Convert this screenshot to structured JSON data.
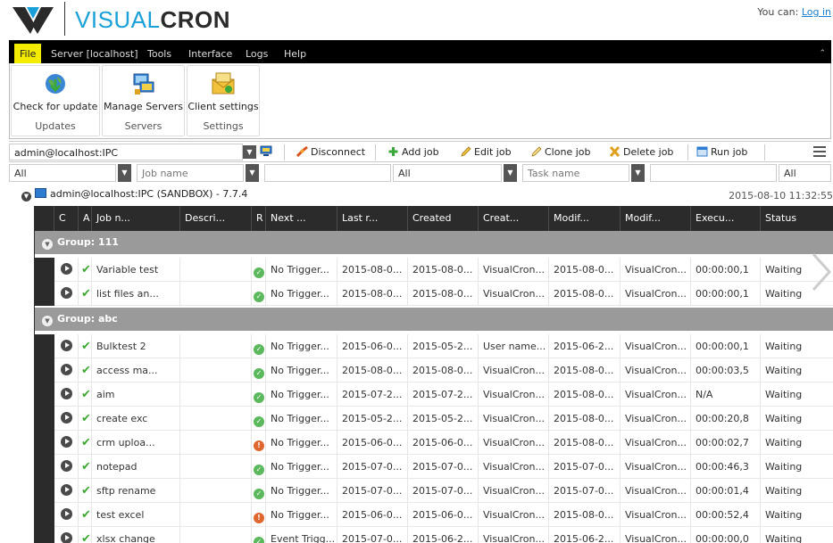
{
  "brand": {
    "text_light": "VISUAL",
    "text_bold": "CRON"
  },
  "account": {
    "prefix": "You can: ",
    "login_link": "Log in"
  },
  "menu": {
    "items": [
      {
        "label": "File",
        "active": true
      },
      {
        "label": "Server [localhost]",
        "active": false
      },
      {
        "label": "Tools",
        "active": false
      },
      {
        "label": "Interface",
        "active": false
      },
      {
        "label": "Logs",
        "active": false
      },
      {
        "label": "Help",
        "active": false
      }
    ],
    "collapse_icon": "chevron-up-icon"
  },
  "ribbon": {
    "groups": [
      {
        "button": "Check for update",
        "group": "Updates",
        "icon": "globe-update-icon"
      },
      {
        "button": "Manage Servers",
        "group": "Servers",
        "icon": "servers-icon"
      },
      {
        "button": "Client settings",
        "group": "Settings",
        "icon": "settings-envelope-icon"
      }
    ]
  },
  "toolbar": {
    "server_combo": "admin@localhost:IPC",
    "disconnect": "Disconnect",
    "add_job": "Add job",
    "edit_job": "Edit job",
    "clone_job": "Clone job",
    "delete_job": "Delete job",
    "run_job": "Run job"
  },
  "filters": {
    "group": "All",
    "job_name_placeholder": "Job name",
    "job_name_value": "",
    "status": "All",
    "task_name_placeholder": "Task name",
    "task_name_value": "",
    "task_status": "All"
  },
  "connection": {
    "label": "admin@localhost:IPC (SANDBOX) - 7.7.4",
    "timestamp": "2015-08-10 11:32:55"
  },
  "grid": {
    "columns": [
      "C",
      "A",
      "Job n...",
      "Descri...",
      "R",
      "Next ...",
      "Last r...",
      "Created",
      "Creat...",
      "Modif...",
      "Modif...",
      "Execu...",
      "Status"
    ],
    "groups": [
      {
        "label": "Group: 111",
        "rows": [
          {
            "name": "Variable test",
            "desc": "",
            "result": "ok",
            "next": "No Trigger...",
            "last": "2015-08-0...",
            "created": "2015-08-0...",
            "created_by": "VisualCron...",
            "modified": "2015-08-0...",
            "modified_by": "VisualCron...",
            "exec": "00:00:00,1",
            "status": "Waiting"
          },
          {
            "name": "list files an...",
            "desc": "",
            "result": "ok",
            "next": "No Trigger...",
            "last": "2015-08-0...",
            "created": "2015-08-0...",
            "created_by": "VisualCron...",
            "modified": "2015-08-0...",
            "modified_by": "VisualCron...",
            "exec": "00:00:00,1",
            "status": "Waiting"
          }
        ]
      },
      {
        "label": "Group: abc",
        "rows": [
          {
            "name": "Bulktest 2",
            "desc": "",
            "result": "ok",
            "next": "No Trigger...",
            "last": "2015-06-0...",
            "created": "2015-05-2...",
            "created_by": "User name...",
            "modified": "2015-06-2...",
            "modified_by": "VisualCron...",
            "exec": "00:00:00,1",
            "status": "Waiting"
          },
          {
            "name": "access ma...",
            "desc": "",
            "result": "ok",
            "next": "No Trigger...",
            "last": "2015-08-0...",
            "created": "2015-08-0...",
            "created_by": "VisualCron...",
            "modified": "2015-08-0...",
            "modified_by": "VisualCron...",
            "exec": "00:00:03,5",
            "status": "Waiting"
          },
          {
            "name": "aim",
            "desc": "",
            "result": "ok",
            "next": "No Trigger...",
            "last": "2015-07-2...",
            "created": "2015-07-2...",
            "created_by": "VisualCron...",
            "modified": "2015-08-0...",
            "modified_by": "VisualCron...",
            "exec": "N/A",
            "status": "Waiting"
          },
          {
            "name": "create exc",
            "desc": "",
            "result": "ok",
            "next": "No Trigger...",
            "last": "2015-05-2...",
            "created": "2015-05-2...",
            "created_by": "VisualCron...",
            "modified": "2015-08-0...",
            "modified_by": "VisualCron...",
            "exec": "00:00:20,8",
            "status": "Waiting"
          },
          {
            "name": "crm uploa...",
            "desc": "",
            "result": "err",
            "next": "No Trigger...",
            "last": "2015-06-0...",
            "created": "2015-06-0...",
            "created_by": "VisualCron...",
            "modified": "2015-08-0...",
            "modified_by": "VisualCron...",
            "exec": "00:00:02,7",
            "status": "Waiting"
          },
          {
            "name": "notepad",
            "desc": "",
            "result": "ok",
            "next": "No Trigger...",
            "last": "2015-07-0...",
            "created": "2015-07-0...",
            "created_by": "VisualCron...",
            "modified": "2015-07-0...",
            "modified_by": "VisualCron...",
            "exec": "00:00:46,3",
            "status": "Waiting"
          },
          {
            "name": "sftp rename",
            "desc": "",
            "result": "ok",
            "next": "No Trigger...",
            "last": "2015-07-0...",
            "created": "2015-07-0...",
            "created_by": "VisualCron...",
            "modified": "2015-07-0...",
            "modified_by": "VisualCron...",
            "exec": "00:00:01,4",
            "status": "Waiting"
          },
          {
            "name": "test excel",
            "desc": "",
            "result": "err",
            "next": "No Trigger...",
            "last": "2015-06-0...",
            "created": "2015-06-0...",
            "created_by": "VisualCron...",
            "modified": "2015-08-0...",
            "modified_by": "VisualCron...",
            "exec": "00:00:52,4",
            "status": "Waiting"
          },
          {
            "name": "xlsx change",
            "desc": "",
            "result": "ok",
            "next": "Event Trigg...",
            "last": "2015-07-0...",
            "created": "2015-06-2...",
            "created_by": "VisualCron...",
            "modified": "2015-06-2...",
            "modified_by": "VisualCron...",
            "exec": "00:00:00,0",
            "status": "Waiting"
          }
        ]
      }
    ]
  },
  "colors": {
    "accent": "#1aa0d8",
    "menu_active": "#f4ec00",
    "header_dark": "#2b2b2b",
    "group_bar": "#9a9a9a",
    "ok": "#5cb85c",
    "error": "#e0662f"
  }
}
